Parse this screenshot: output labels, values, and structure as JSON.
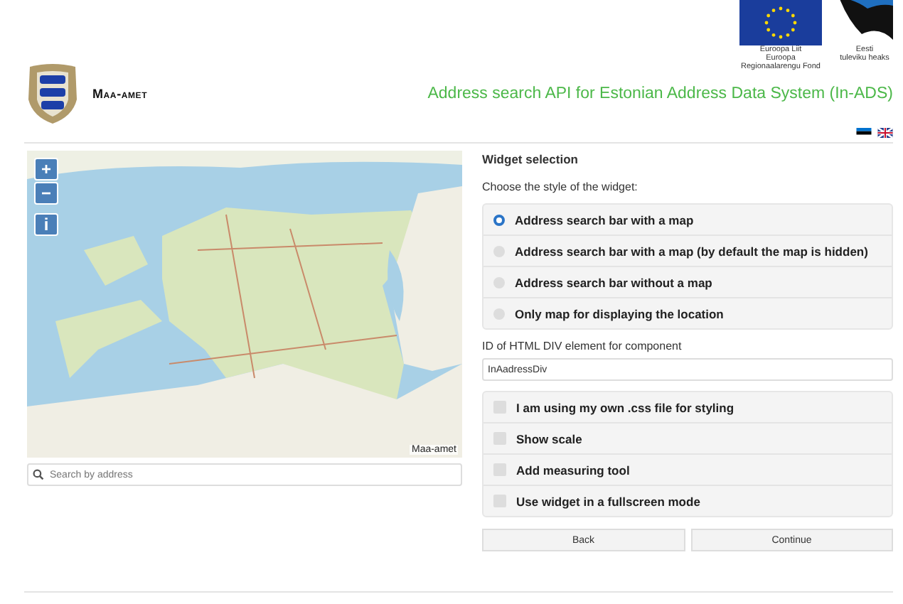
{
  "header": {
    "org_name": "Maa-amet",
    "eu_caption": [
      "Euroopa Liit",
      "Euroopa",
      "Regionaalarengu Fond"
    ],
    "ee_caption": [
      "Eesti",
      "tuleviku heaks"
    ],
    "title": "Address search API for Estonian Address Data System (In-ADS)"
  },
  "map": {
    "controls": [
      "+",
      "−",
      "i"
    ],
    "attribution": "Maa-amet",
    "search_placeholder": "Search by address"
  },
  "panel": {
    "heading": "Widget selection",
    "prompt": "Choose the style of the widget:",
    "styles": [
      {
        "label": "Address search bar with a map",
        "selected": true
      },
      {
        "label": "Address search bar with a map (by default the map is hidden)",
        "selected": false
      },
      {
        "label": "Address search bar without a map",
        "selected": false
      },
      {
        "label": "Only map for displaying the location",
        "selected": false
      }
    ],
    "div_id_label": "ID of HTML DIV element for component",
    "div_id_value": "InAadressDiv",
    "options": [
      {
        "label": "I am using my own .css file for styling",
        "checked": false
      },
      {
        "label": "Show scale",
        "checked": false
      },
      {
        "label": "Add measuring tool",
        "checked": false
      },
      {
        "label": "Use widget in a fullscreen mode",
        "checked": false
      }
    ],
    "buttons": [
      "Back",
      "Continue"
    ]
  }
}
